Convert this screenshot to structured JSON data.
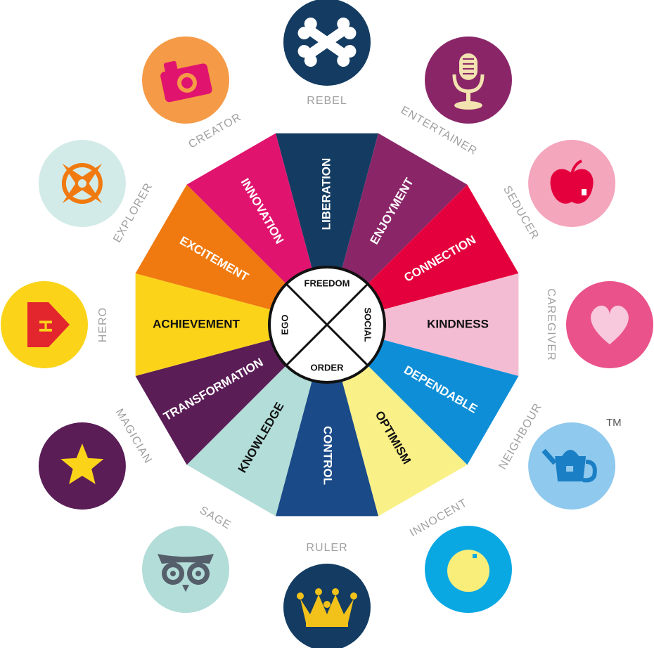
{
  "segments": [
    {
      "label": "LIBERATION",
      "color": "#143c62",
      "text_color": "#ffffff"
    },
    {
      "label": "ENJOYMENT",
      "color": "#8a2668",
      "text_color": "#ffffff"
    },
    {
      "label": "CONNECTION",
      "color": "#e4003c",
      "text_color": "#ffffff"
    },
    {
      "label": "KINDNESS",
      "color": "#f4bcd2",
      "text_color": "#111111"
    },
    {
      "label": "DEPENDABLE",
      "color": "#0e8ed7",
      "text_color": "#ffffff"
    },
    {
      "label": "OPTIMISM",
      "color": "#faf088",
      "text_color": "#111111"
    },
    {
      "label": "CONTROL",
      "color": "#1a4a88",
      "text_color": "#ffffff"
    },
    {
      "label": "KNOWLEDGE",
      "color": "#b3ddd8",
      "text_color": "#111111"
    },
    {
      "label": "TRANSFORMATION",
      "color": "#5a1d56",
      "text_color": "#ffffff"
    },
    {
      "label": "ACHIEVEMENT",
      "color": "#fbd41a",
      "text_color": "#111111"
    },
    {
      "label": "EXCITEMENT",
      "color": "#f07a10",
      "text_color": "#ffffff"
    },
    {
      "label": "INNOVATION",
      "color": "#e0146e",
      "text_color": "#ffffff"
    }
  ],
  "archetypes": [
    {
      "label": "REBEL",
      "icon": "crossbones-icon",
      "circle_color": "#143c62"
    },
    {
      "label": "ENTERTAINER",
      "icon": "microphone-icon",
      "circle_color": "#8a2668"
    },
    {
      "label": "SEDUCER",
      "icon": "apple-icon",
      "circle_color": "#f4a6bd"
    },
    {
      "label": "CAREGIVER",
      "icon": "heart-icon",
      "circle_color": "#e9528a"
    },
    {
      "label": "NEIGHBOUR",
      "icon": "teapot-icon",
      "circle_color": "#90c9ee"
    },
    {
      "label": "INNOCENT",
      "icon": "balloon-icon",
      "circle_color": "#0aa8e3"
    },
    {
      "label": "RULER",
      "icon": "crown-icon",
      "circle_color": "#143c62"
    },
    {
      "label": "SAGE",
      "icon": "owl-icon",
      "circle_color": "#b3ddd8"
    },
    {
      "label": "MAGICIAN",
      "icon": "star-icon",
      "circle_color": "#5a1d56"
    },
    {
      "label": "HERO",
      "icon": "hero-badge-icon",
      "circle_color": "#fbd41a"
    },
    {
      "label": "EXPLORER",
      "icon": "compass-icon",
      "circle_color": "#d3ebe8"
    },
    {
      "label": "CREATOR",
      "icon": "camera-icon",
      "circle_color": "#f59a46"
    }
  ],
  "core": [
    "FREEDOM",
    "SOCIAL",
    "ORDER",
    "EGO"
  ],
  "hero_letter": "H",
  "trademark": "TM"
}
